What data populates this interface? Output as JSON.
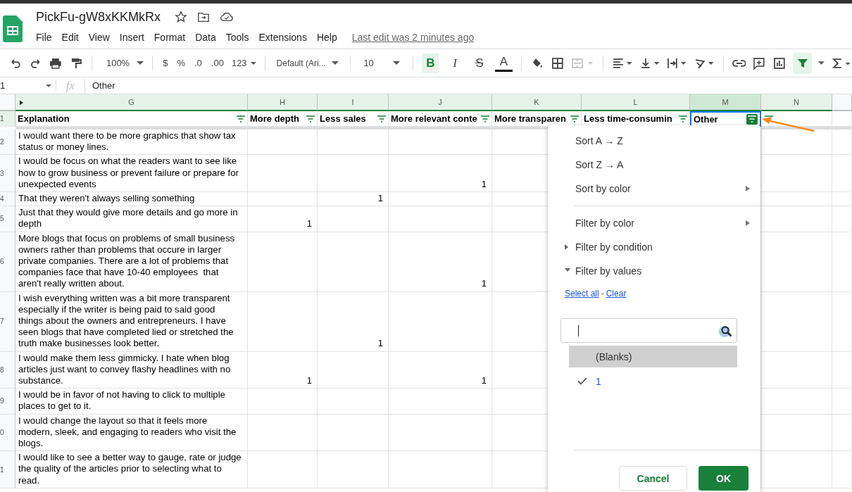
{
  "document": {
    "title": "PickFu-gW8xKKMkRx",
    "last_edit": "Last edit was 2 minutes ago"
  },
  "menu_bar": [
    "File",
    "Edit",
    "View",
    "Insert",
    "Format",
    "Data",
    "Tools",
    "Extensions",
    "Help"
  ],
  "toolbar": {
    "zoom": "100%",
    "currency": "$",
    "percent": "%",
    "decrease_decimals": ".0",
    "increase_decimals": ".00",
    "number_format": "123",
    "font": "Default (Ari...",
    "font_size": "10",
    "bold": {
      "label": "B",
      "on": true
    },
    "italic": "I",
    "strikethrough": "S",
    "text_color": "A",
    "filter_on": true
  },
  "formula_bar": {
    "cell": "1",
    "fx": "fx",
    "value": "Other"
  },
  "columns": [
    {
      "letter": "G",
      "selected": false,
      "header": "Explanation",
      "filter_on": false
    },
    {
      "letter": "H",
      "selected": false,
      "header": "More depth",
      "filter_on": false
    },
    {
      "letter": "I",
      "selected": false,
      "header": "Less sales",
      "filter_on": false
    },
    {
      "letter": "J",
      "selected": false,
      "header": "More relevant conte",
      "filter_on": false
    },
    {
      "letter": "K",
      "selected": false,
      "header": "More transparen",
      "filter_on": false
    },
    {
      "letter": "L",
      "selected": false,
      "header": "Less time-consumin",
      "filter_on": false
    },
    {
      "letter": "M",
      "selected": true,
      "header": "Other",
      "filter_on": true
    },
    {
      "letter": "N",
      "selected": false,
      "filter_on": false
    }
  ],
  "header_row_number": "1",
  "rows": [
    {
      "number": "2",
      "explanation": "I would want there to be more graphics that show tax status or money lines."
    },
    {
      "number": "3",
      "explanation": "I would be focus on what the readers want to see like how to grow business or prevent failure or prepare for unexpected events",
      "J": "1"
    },
    {
      "number": "4",
      "explanation": "That they weren't always selling something",
      "I": "1"
    },
    {
      "number": "5",
      "explanation": "Just that they would give more details and go more in depth",
      "H": "1"
    },
    {
      "number": "6",
      "explanation": "More blogs that focus on problems of small business owners rather than problems that occure in larger private companies. There are a lot of problems that companies face that have 10-40 employees  that aren't really written about.",
      "J": "1"
    },
    {
      "number": "7",
      "explanation": "I wish everything written was a bit more transparent especially if the writer is being paid to said good things about the owners and entrepreneurs. I have seen blogs that have completed lied or stretched the truth make businesses look better.",
      "I": "1"
    },
    {
      "number": "8",
      "explanation": "I would make them less gimmicky. I hate when blog articles just want to convey flashy headlines with no substance.",
      "H": "1",
      "J": "1"
    },
    {
      "number": "9",
      "explanation": "I would be in favor of not having to click to multiple places to get to it."
    },
    {
      "number": "0",
      "explanation": "I would change the layout so that it feels more modern, sleek, and engaging to readers who visit the blogs."
    },
    {
      "number": "1",
      "explanation": "I would like to see a better way to gauge, rate or judge the quality of the articles prior to selecting what to read."
    }
  ],
  "filter_menu": {
    "items": [
      {
        "label": "Sort A → Z",
        "kind": "plain"
      },
      {
        "label": "Sort Z → A",
        "kind": "plain"
      },
      {
        "label": "Sort by color",
        "kind": "submenu"
      },
      {
        "kind": "divider"
      },
      {
        "label": "Filter by color",
        "kind": "submenu"
      },
      {
        "label": "Filter by condition",
        "kind": "collapsed"
      },
      {
        "label": "Filter by values",
        "kind": "expanded"
      }
    ],
    "select_all": "Select all",
    "separator": "-",
    "clear": "Clear",
    "values": [
      {
        "label": "(Blanks)",
        "checked": false,
        "highlighted": true
      },
      {
        "label": "1",
        "checked": true,
        "highlighted": false
      }
    ],
    "buttons": {
      "cancel": "Cancel",
      "ok": "OK"
    }
  }
}
